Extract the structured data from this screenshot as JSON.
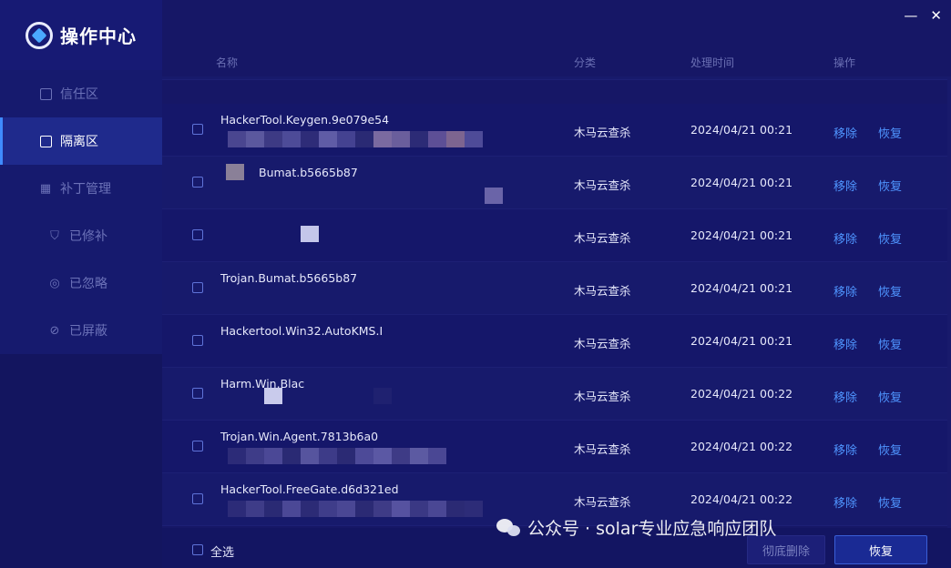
{
  "app": {
    "title": "操作中心"
  },
  "window_controls": {
    "minimize": "—",
    "close": "✕"
  },
  "sidebar": {
    "items": [
      {
        "label": "信任区",
        "icon": "checklist-icon",
        "active": false,
        "sub": false
      },
      {
        "label": "隔离区",
        "icon": "quarantine-icon",
        "active": true,
        "sub": false
      },
      {
        "label": "补丁管理",
        "icon": "grid-icon",
        "active": false,
        "sub": false
      },
      {
        "label": "已修补",
        "icon": "shield-check-icon",
        "active": false,
        "sub": true
      },
      {
        "label": "已忽略",
        "icon": "eye-off-icon",
        "active": false,
        "sub": true
      },
      {
        "label": "已屏蔽",
        "icon": "block-icon",
        "active": false,
        "sub": true
      }
    ]
  },
  "table": {
    "headers": {
      "name": "名称",
      "category": "分类",
      "time": "处理时间",
      "action": "操作"
    },
    "rows": [
      {
        "name": "HackerTool.Keygen.9e079e54",
        "category": "木马云查杀",
        "time": "2024/04/21 00:21",
        "remove": "移除",
        "restore": "恢复"
      },
      {
        "name": "Bumat.b5665b87",
        "category": "木马云查杀",
        "time": "2024/04/21 00:21",
        "remove": "移除",
        "restore": "恢复"
      },
      {
        "name": "",
        "category": "木马云查杀",
        "time": "2024/04/21 00:21",
        "remove": "移除",
        "restore": "恢复"
      },
      {
        "name": "Trojan.Bumat.b5665b87",
        "category": "木马云查杀",
        "time": "2024/04/21 00:21",
        "remove": "移除",
        "restore": "恢复"
      },
      {
        "name": "Hackertool.Win32.AutoKMS.I",
        "category": "木马云查杀",
        "time": "2024/04/21 00:21",
        "remove": "移除",
        "restore": "恢复"
      },
      {
        "name": "Harm.Win.Blac",
        "category": "木马云查杀",
        "time": "2024/04/21 00:22",
        "remove": "移除",
        "restore": "恢复"
      },
      {
        "name": "Trojan.Win.Agent.7813b6a0",
        "category": "木马云查杀",
        "time": "2024/04/21 00:22",
        "remove": "移除",
        "restore": "恢复"
      },
      {
        "name": "HackerTool.FreeGate.d6d321ed",
        "category": "木马云查杀",
        "time": "2024/04/21 00:22",
        "remove": "移除",
        "restore": "恢复"
      }
    ]
  },
  "footer": {
    "select_all": "全选",
    "delete_label": "彻底删除",
    "restore_label": "恢复"
  },
  "watermark": "公众号 · solar专业应急响应团队",
  "colors": {
    "accent": "#4f95ff",
    "background": "#161766",
    "sidebar": "#13155f"
  }
}
